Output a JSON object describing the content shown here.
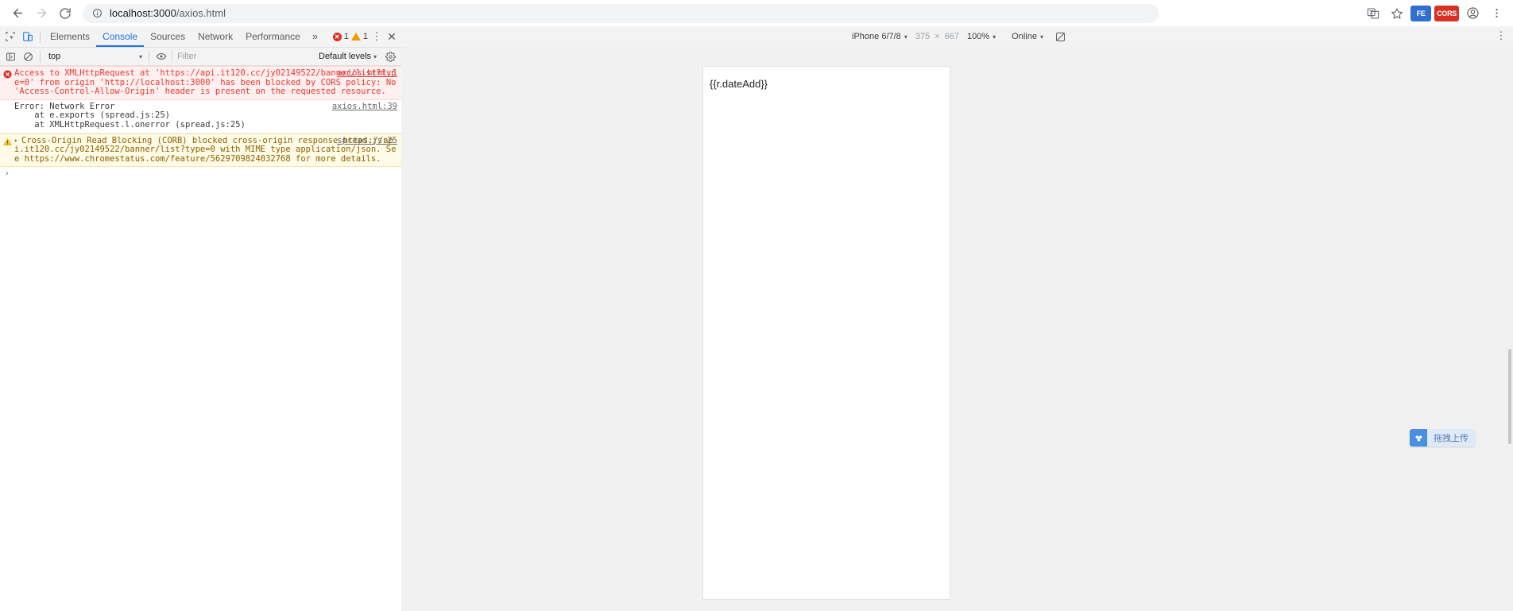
{
  "browser": {
    "back_label": "Back",
    "forward_label": "Forward",
    "reload_label": "Reload",
    "site_info_label": "site-information",
    "url_host": "localhost:3000",
    "url_path": "/axios.html",
    "translate_label": "Translate",
    "bookmark_label": "Bookmark this tab",
    "ext_fe_label": "FE",
    "ext_cors_label": "CORS",
    "profile_label": "Profile",
    "menu_label": "Customize and control Google Chrome"
  },
  "devtools": {
    "inspect_label": "Inspect element",
    "device_toggle_label": "Toggle device toolbar",
    "tabs": [
      {
        "label": "Elements",
        "selected": false
      },
      {
        "label": "Console",
        "selected": true
      },
      {
        "label": "Sources",
        "selected": false
      },
      {
        "label": "Network",
        "selected": false
      },
      {
        "label": "Performance",
        "selected": false
      }
    ],
    "more_tabs_label": "»",
    "error_count": "1",
    "warning_count": "1",
    "kebab_label": "⋮",
    "close_label": "✕",
    "toolbar": {
      "clear_console_label": "Clear console",
      "sidebar_toggle_label": "Show console sidebar",
      "context": "top",
      "caret": "▾",
      "eye_label": "Create live expression",
      "filter_placeholder": "Filter",
      "levels": "Default levels",
      "settings_label": "Console settings"
    },
    "messages": [
      {
        "type": "error",
        "source": "axios.html:1",
        "parts": [
          {
            "t": "Access to XMLHttpRequest at '",
            "link": false
          },
          {
            "t": "https://api.it120.cc/jy02149522/banner/list?type=0",
            "link": true
          },
          {
            "t": "' from origin '",
            "link": false
          },
          {
            "t": "http://localhost:3000",
            "link": true
          },
          {
            "t": "' has been blocked by CORS policy: No 'Access-Control-Allow-Origin' header is present on the requested resource.",
            "link": false
          }
        ]
      },
      {
        "type": "plain",
        "source": "axios.html:39",
        "parts": [
          {
            "t": "Error: Network Error\n    at e.exports (",
            "link": false
          },
          {
            "t": "spread.js:25",
            "link": true
          },
          {
            "t": ")\n    at XMLHttpRequest.l.onerror (",
            "link": false
          },
          {
            "t": "spread.js:25",
            "link": true
          },
          {
            "t": ")",
            "link": false
          }
        ]
      },
      {
        "type": "warning",
        "source": "spread.js:25",
        "disclosure": "▸",
        "parts": [
          {
            "t": "Cross-Origin Read Blocking (CORB) blocked cross-origin response ",
            "link": false
          },
          {
            "t": "https://api.it120.cc/jy02149522/banner/list?type=0",
            "link": true
          },
          {
            "t": " with MIME type application/json. See ",
            "link": false
          },
          {
            "t": "https://www.chromestatus.com/feature/5629709824032768",
            "link": true
          },
          {
            "t": " for more details.",
            "link": false
          }
        ]
      }
    ],
    "prompt_caret": "›"
  },
  "device_toolbar": {
    "device": "iPhone 6/7/8",
    "caret": "▾",
    "width": "375",
    "x_symbol": "×",
    "height": "667",
    "zoom": "100%",
    "network": "Online",
    "rotate_label": "Rotate",
    "kebab_label": "⋮"
  },
  "viewport": {
    "page_text": "{{r.dateAdd}}"
  },
  "upload_widget": {
    "icon_name": "cloud-upload-icon",
    "label": "拖拽上传"
  },
  "colors": {
    "accent": "#1a73e8",
    "error": "#d93025",
    "warning": "#f29900",
    "error_bg": "#fff0f0",
    "warning_bg": "#fffbe6",
    "stage_bg": "#f1f1f1",
    "upload_blue": "#4a90e2"
  }
}
